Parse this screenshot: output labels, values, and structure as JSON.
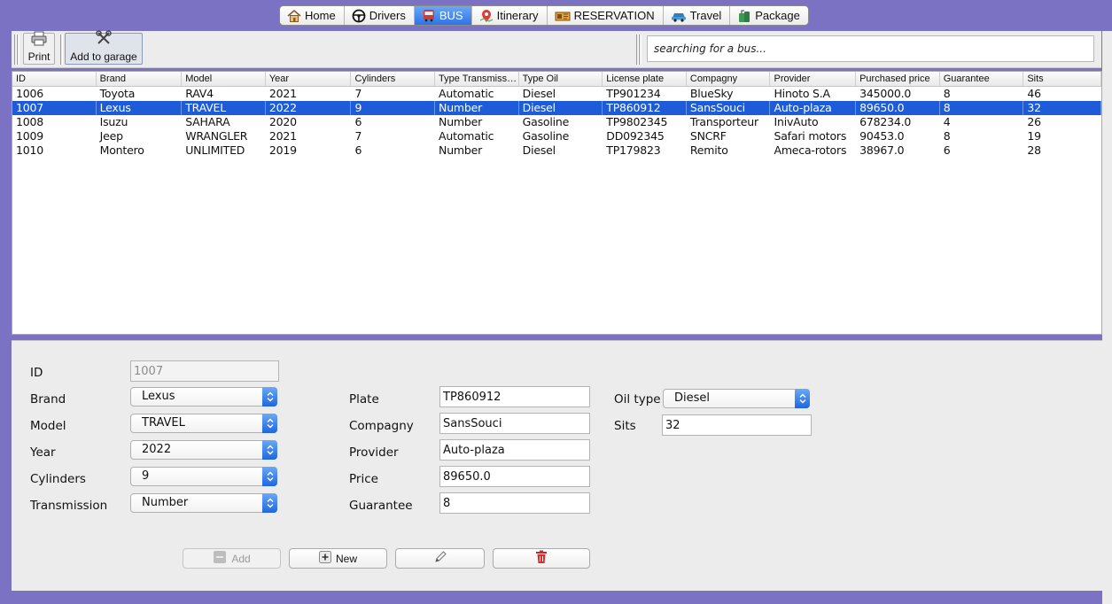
{
  "tabs": [
    {
      "label": "Home",
      "icon": "home-icon"
    },
    {
      "label": "Drivers",
      "icon": "steering-wheel-icon"
    },
    {
      "label": "BUS",
      "icon": "bus-icon",
      "active": true
    },
    {
      "label": "Itinerary",
      "icon": "map-pin-icon"
    },
    {
      "label": "RESERVATION",
      "icon": "ticket-icon"
    },
    {
      "label": "Travel",
      "icon": "car-icon"
    },
    {
      "label": "Package",
      "icon": "luggage-icon"
    }
  ],
  "toolbar": {
    "print_label": "Print",
    "garage_label": "Add to garage",
    "search_placeholder": "searching for a bus..."
  },
  "table": {
    "columns": [
      "ID",
      "Brand",
      "Model",
      "Year",
      "Cylinders",
      "Type Transmission",
      "Type Oil",
      "License plate",
      "Compagny",
      "Provider",
      "Purchased price",
      "Guarantee",
      "Sits"
    ],
    "rows": [
      [
        "1006",
        "Toyota",
        "RAV4",
        "2021",
        "7",
        "Automatic",
        "Diesel",
        "TP901234",
        "BlueSky",
        "Hinoto S.A",
        "345000.0",
        "8",
        "46"
      ],
      [
        "1007",
        "Lexus",
        "TRAVEL",
        "2022",
        "9",
        "Number",
        "Diesel",
        "TP860912",
        "SansSouci",
        "Auto-plaza",
        "89650.0",
        "8",
        "32"
      ],
      [
        "1008",
        "Isuzu",
        "SAHARA",
        "2020",
        "6",
        "Number",
        "Gasoline",
        "TP9802345",
        "Transporteur",
        "InivAuto",
        "678234.0",
        "4",
        "26"
      ],
      [
        "1009",
        "Jeep",
        "WRANGLER",
        "2021",
        "7",
        "Automatic",
        "Gasoline",
        "DD092345",
        "SNCRF",
        "Safari motors",
        "90453.0",
        "8",
        "19"
      ],
      [
        "1010",
        "Montero",
        "UNLIMITED",
        "2019",
        "6",
        "Number",
        "Diesel",
        "TP179823",
        "Remito",
        "Ameca-rotors",
        "38967.0",
        "6",
        "28"
      ]
    ],
    "selected_index": 1
  },
  "form": {
    "labels": {
      "id": "ID",
      "brand": "Brand",
      "model": "Model",
      "year": "Year",
      "cylinders": "Cylinders",
      "transmission": "Transmission",
      "plate": "Plate",
      "compagny": "Compagny",
      "provider": "Provider",
      "price": "Price",
      "guarantee": "Guarantee",
      "oil_type": "Oil type",
      "sits": "Sits"
    },
    "values": {
      "id": "1007",
      "brand": "Lexus",
      "model": "TRAVEL",
      "year": "2022",
      "cylinders": "9",
      "transmission": "Number",
      "plate": "TP860912",
      "compagny": "SansSouci",
      "provider": "Auto-plaza",
      "price": "89650.0",
      "guarantee": "8",
      "oil_type": "Diesel",
      "sits": "32"
    }
  },
  "actions": {
    "add_label": "Add",
    "new_label": "New"
  },
  "colors": {
    "frame": "#7b72c4",
    "selection": "#1d5bd8",
    "tab_active": "#2e73e6"
  }
}
